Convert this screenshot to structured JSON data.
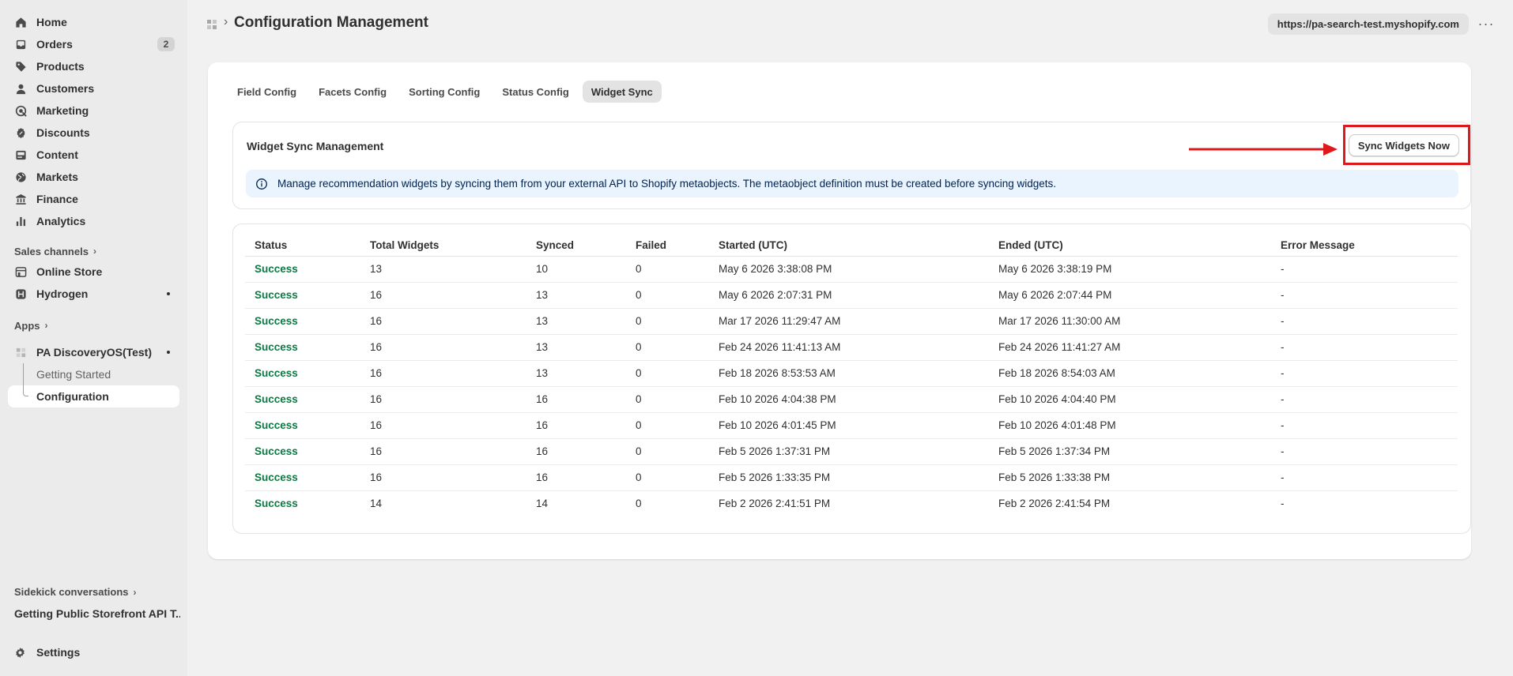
{
  "sidebar": {
    "items": [
      {
        "label": "Home",
        "icon": "home-icon"
      },
      {
        "label": "Orders",
        "icon": "inbox-icon",
        "badge": "2"
      },
      {
        "label": "Products",
        "icon": "tag-icon"
      },
      {
        "label": "Customers",
        "icon": "person-icon"
      },
      {
        "label": "Marketing",
        "icon": "target-icon"
      },
      {
        "label": "Discounts",
        "icon": "discount-icon"
      },
      {
        "label": "Content",
        "icon": "content-icon"
      },
      {
        "label": "Markets",
        "icon": "globe-icon"
      },
      {
        "label": "Finance",
        "icon": "bank-icon"
      },
      {
        "label": "Analytics",
        "icon": "bar-chart-icon"
      }
    ],
    "sales_channels_label": "Sales channels",
    "channels": [
      {
        "label": "Online Store",
        "icon": "store-icon"
      },
      {
        "label": "Hydrogen",
        "icon": "hydrogen-icon"
      }
    ],
    "apps_label": "Apps",
    "app": {
      "label": "PA DiscoveryOS(Test)",
      "sub_items": [
        "Getting Started",
        "Configuration"
      ]
    },
    "sidekick_label": "Sidekick conversations",
    "sidekick_item": "Getting Public Storefront API T...",
    "settings_label": "Settings"
  },
  "header": {
    "title": "Configuration Management",
    "url": "https://pa-search-test.myshopify.com",
    "more": "···"
  },
  "tabs": [
    "Field Config",
    "Facets Config",
    "Sorting Config",
    "Status Config",
    "Widget Sync"
  ],
  "active_tab": "Widget Sync",
  "sync": {
    "title": "Widget Sync Management",
    "button_label": "Sync Widgets Now",
    "info_text": "Manage recommendation widgets by syncing them from your external API to Shopify metaobjects. The metaobject definition must be created before syncing widgets."
  },
  "table": {
    "headers": [
      "Status",
      "Total Widgets",
      "Synced",
      "Failed",
      "Started (UTC)",
      "Ended (UTC)",
      "Error Message"
    ],
    "rows": [
      [
        "Success",
        "13",
        "10",
        "0",
        "May 6 2026 3:38:08 PM",
        "May 6 2026 3:38:19 PM",
        "-"
      ],
      [
        "Success",
        "16",
        "13",
        "0",
        "May 6 2026 2:07:31 PM",
        "May 6 2026 2:07:44 PM",
        "-"
      ],
      [
        "Success",
        "16",
        "13",
        "0",
        "Mar 17 2026 11:29:47 AM",
        "Mar 17 2026 11:30:00 AM",
        "-"
      ],
      [
        "Success",
        "16",
        "13",
        "0",
        "Feb 24 2026 11:41:13 AM",
        "Feb 24 2026 11:41:27 AM",
        "-"
      ],
      [
        "Success",
        "16",
        "13",
        "0",
        "Feb 18 2026 8:53:53 AM",
        "Feb 18 2026 8:54:03 AM",
        "-"
      ],
      [
        "Success",
        "16",
        "16",
        "0",
        "Feb 10 2026 4:04:38 PM",
        "Feb 10 2026 4:04:40 PM",
        "-"
      ],
      [
        "Success",
        "16",
        "16",
        "0",
        "Feb 10 2026 4:01:45 PM",
        "Feb 10 2026 4:01:48 PM",
        "-"
      ],
      [
        "Success",
        "16",
        "16",
        "0",
        "Feb 5 2026 1:37:31 PM",
        "Feb 5 2026 1:37:34 PM",
        "-"
      ],
      [
        "Success",
        "16",
        "16",
        "0",
        "Feb 5 2026 1:33:35 PM",
        "Feb 5 2026 1:33:38 PM",
        "-"
      ],
      [
        "Success",
        "14",
        "14",
        "0",
        "Feb 2 2026 2:41:51 PM",
        "Feb 2 2026 2:41:54 PM",
        "-"
      ]
    ]
  },
  "colors": {
    "success": "#0c7a43",
    "highlight": "#e0181c",
    "info_bg": "#eaf4ff"
  }
}
